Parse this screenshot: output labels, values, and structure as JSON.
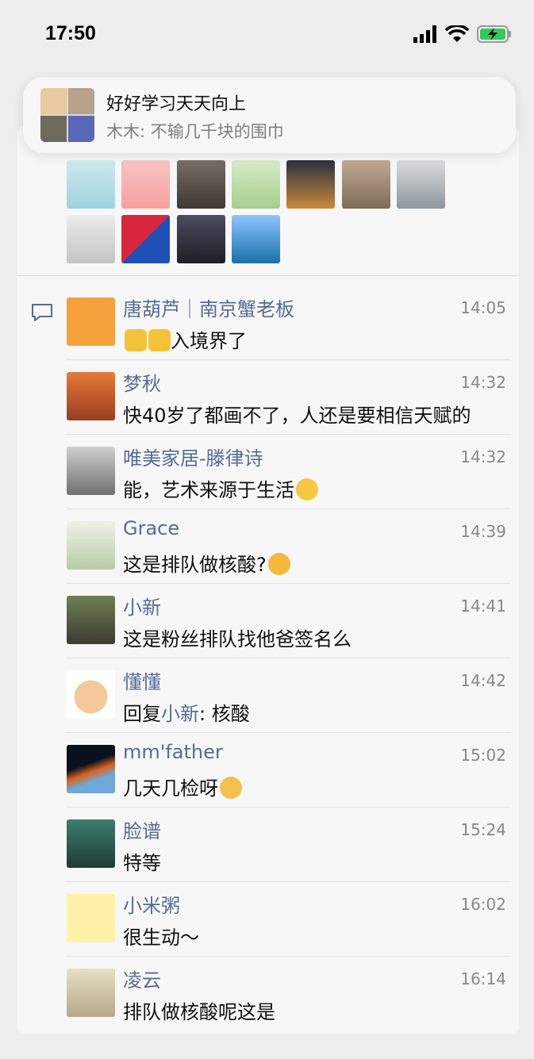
{
  "status": {
    "time": "17:50"
  },
  "notification": {
    "title": "好好学习天天向上",
    "message": "木木: 不输几千块的围巾"
  },
  "likes": [
    {
      "icon": "avatar-nurse"
    },
    {
      "icon": "avatar-panda"
    },
    {
      "icon": "avatar-women-walking"
    },
    {
      "icon": "avatar-cartoon-girl"
    },
    {
      "icon": "avatar-sunset"
    },
    {
      "icon": "avatar-woman-field"
    },
    {
      "icon": "avatar-woman-portrait"
    },
    {
      "icon": "avatar-woman-laptop"
    },
    {
      "icon": "avatar-h-logo"
    },
    {
      "icon": "avatar-silhouette"
    },
    {
      "icon": "avatar-lake"
    }
  ],
  "comments": [
    {
      "name": "唐葫芦｜南京蟹老板",
      "time": "14:05",
      "text": "入境界了",
      "prefix_emoji": "thumbs-up-icon x2"
    },
    {
      "name": "梦秋",
      "time": "14:32",
      "text": "快40岁了都画不了，人还是要相信天赋的"
    },
    {
      "name": "唯美家居-滕律诗",
      "time": "14:32",
      "text": "能，艺术来源于生活",
      "suffix_emoji": "grin-emoji"
    },
    {
      "name": "Grace",
      "time": "14:39",
      "text": "这是排队做核酸?",
      "suffix_emoji": "thinking-emoji"
    },
    {
      "name": "小新",
      "time": "14:41",
      "text": "这是粉丝排队找他爸签名么"
    },
    {
      "name": "懂懂",
      "time": "14:42",
      "reply_label": "回复",
      "reply_to": "小新",
      "reply_text": ": 核酸"
    },
    {
      "name": "mm'father",
      "time": "15:02",
      "text": "几天几检呀",
      "suffix_emoji": "cat-emoji"
    },
    {
      "name": "脸谱",
      "time": "15:24",
      "text": "特等"
    },
    {
      "name": "小米粥",
      "time": "16:02",
      "text": "很生动～"
    },
    {
      "name": "凌云",
      "time": "16:14",
      "text": "排队做核酸呢这是"
    }
  ],
  "colors": {
    "link": "#576b95",
    "background": "#ededed",
    "card": "#f7f7f7"
  }
}
